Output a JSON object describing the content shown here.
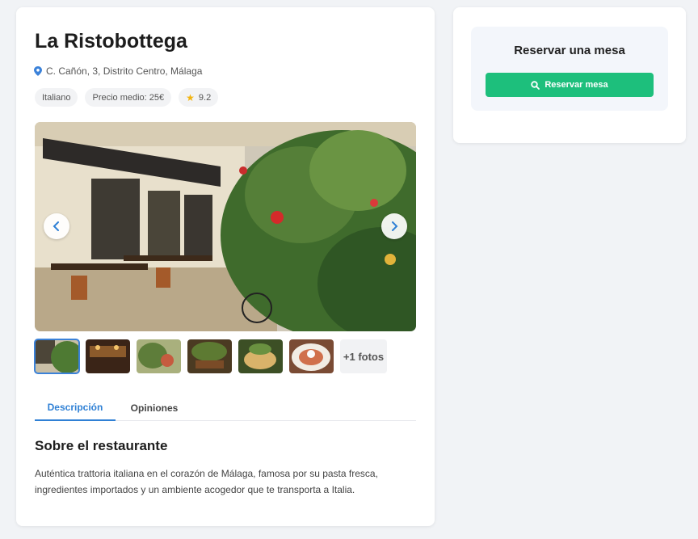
{
  "restaurant": {
    "name": "La Ristobottega",
    "address": "C. Cañón, 3, Distrito Centro, Málaga",
    "tags": {
      "cuisine": "Italiano",
      "price": "Precio medio: 25€",
      "rating": "9.2"
    }
  },
  "gallery": {
    "more_photos": "+1 fotos",
    "thumbnail_count": 6,
    "active_thumbnail": 1
  },
  "tabs": {
    "description": "Descripción",
    "reviews": "Opiniones",
    "active": "description"
  },
  "about": {
    "title": "Sobre el restaurante",
    "text": "Auténtica trattoria italiana en el corazón de Málaga, famosa por su pasta fresca, ingredientes importados y un ambiente acogedor que te transporta a Italia."
  },
  "reservation": {
    "title": "Reservar una mesa",
    "button_label": "Reservar mesa"
  },
  "colors": {
    "accent": "#2f80d5",
    "reserve_button": "#1dbf7c",
    "star": "#f2b40f",
    "location_pin": "#3b82d9"
  },
  "icons": [
    "location-pin-icon",
    "star-icon",
    "chevron-left-icon",
    "chevron-right-icon",
    "search-icon"
  ]
}
